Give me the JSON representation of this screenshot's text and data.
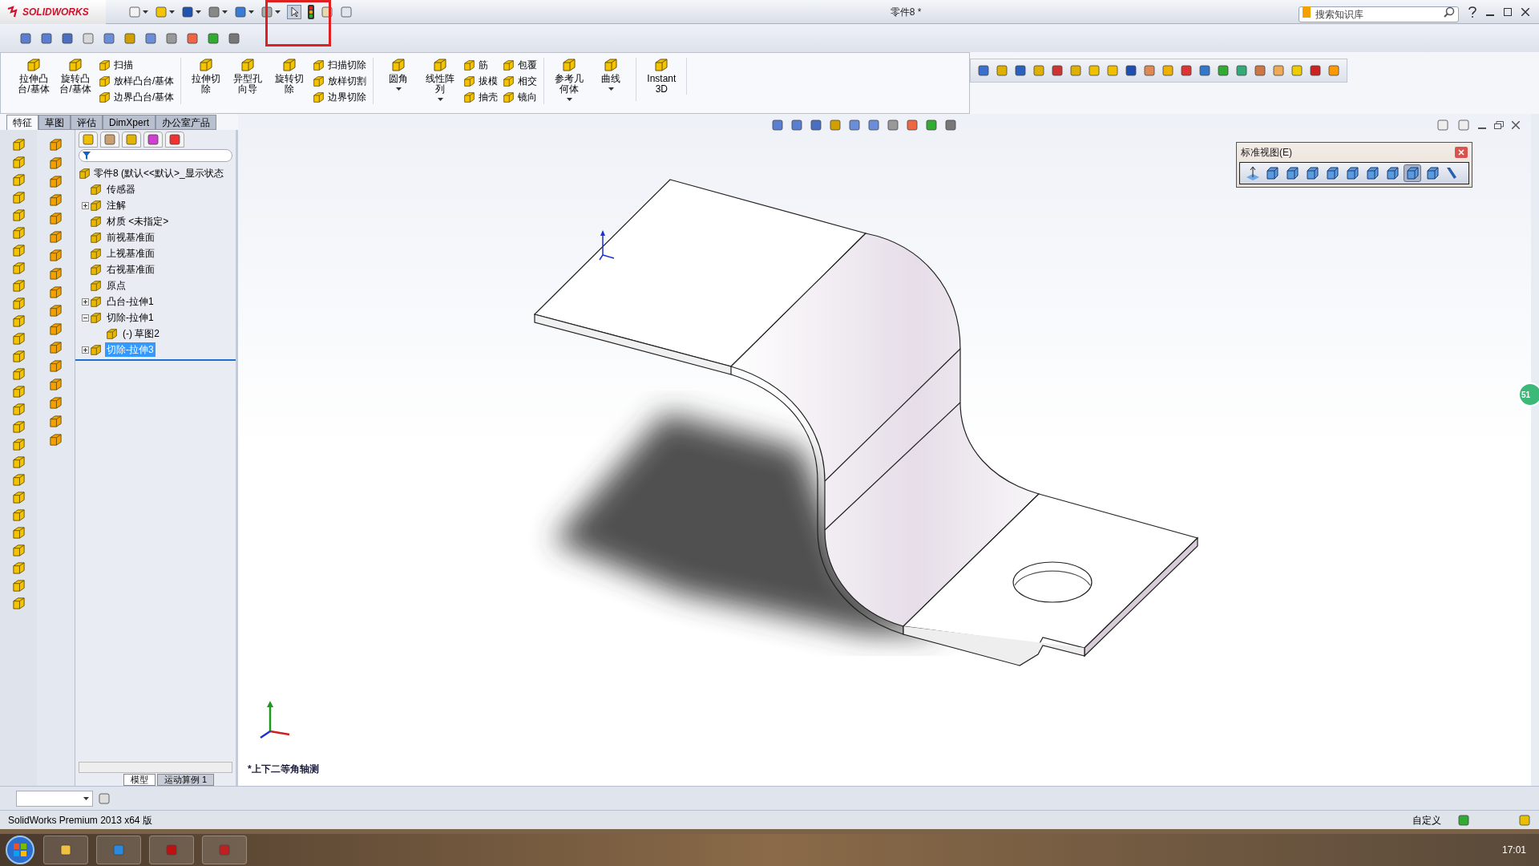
{
  "title_bar": {
    "logo": "SOLIDWORKS",
    "document_title": "零件8 *",
    "search": {
      "placeholder": "搜索知识库"
    }
  },
  "command_manager": {
    "groups": [
      {
        "items": [
          {
            "kind": "large",
            "label": "拉伸凸台/基体"
          },
          {
            "kind": "large",
            "label": "旋转凸台/基体"
          },
          {
            "kind": "column",
            "children": [
              {
                "label": "扫描"
              },
              {
                "label": "放样凸台/基体"
              },
              {
                "label": "边界凸台/基体"
              }
            ]
          }
        ]
      },
      {
        "items": [
          {
            "kind": "large",
            "label": "拉伸切除"
          },
          {
            "kind": "large",
            "label": "异型孔向导"
          },
          {
            "kind": "large",
            "label": "旋转切除"
          },
          {
            "kind": "column",
            "children": [
              {
                "label": "扫描切除"
              },
              {
                "label": "放样切割"
              },
              {
                "label": "边界切除"
              }
            ]
          }
        ]
      },
      {
        "items": [
          {
            "kind": "dropdown",
            "label": "圆角"
          },
          {
            "kind": "dropdown",
            "label": "线性阵列"
          },
          {
            "kind": "column",
            "children": [
              {
                "label": "筋"
              },
              {
                "label": "拔模"
              },
              {
                "label": "抽壳"
              }
            ]
          },
          {
            "kind": "column",
            "children": [
              {
                "label": "包覆"
              },
              {
                "label": "相交"
              },
              {
                "label": "镜向"
              }
            ]
          }
        ]
      },
      {
        "items": [
          {
            "kind": "dropdown",
            "label": "参考几何体"
          },
          {
            "kind": "dropdown",
            "label": "曲线"
          }
        ]
      },
      {
        "items": [
          {
            "kind": "large",
            "label": "Instant3D"
          }
        ]
      }
    ]
  },
  "tabs": [
    {
      "label": "特征",
      "selected": true
    },
    {
      "label": "草图",
      "selected": false
    },
    {
      "label": "评估",
      "selected": false
    },
    {
      "label": "DimXpert",
      "selected": false
    },
    {
      "label": "办公室产品",
      "selected": false
    }
  ],
  "feature_tree": {
    "root": "零件8  (默认<<默认>_显示状态",
    "items": [
      {
        "label": "传感器",
        "selected": false
      },
      {
        "label": "注解",
        "expanded": false,
        "selected": false
      },
      {
        "label": "材质 <未指定>",
        "selected": false
      },
      {
        "label": "前视基准面",
        "selected": false
      },
      {
        "label": "上视基准面",
        "selected": false
      },
      {
        "label": "右视基准面",
        "selected": false
      },
      {
        "label": "原点",
        "selected": false
      },
      {
        "label": "凸台-拉伸1",
        "expanded": false,
        "selected": false
      },
      {
        "label": "切除-拉伸1",
        "expanded": true,
        "selected": false,
        "children": [
          {
            "label": "(-) 草图2",
            "selected": false
          }
        ]
      },
      {
        "label": "切除-拉伸3",
        "expanded": false,
        "selected": true
      }
    ]
  },
  "standard_views": {
    "title": "标准视图(E)",
    "views": [
      {
        "selected": false
      },
      {
        "selected": false
      },
      {
        "selected": false
      },
      {
        "selected": false
      },
      {
        "selected": false
      },
      {
        "selected": false
      },
      {
        "selected": false
      },
      {
        "selected": true
      },
      {
        "selected": false
      }
    ]
  },
  "viewport": {
    "view_name": "*上下二等角轴测",
    "side_badge": "51"
  },
  "bottom_tabs": [
    {
      "label": "模型",
      "selected": true
    },
    {
      "label": "运动算例 1",
      "selected": false
    }
  ],
  "status_bar": {
    "product": "SolidWorks Premium 2013 x64 版",
    "units": "自定义"
  },
  "taskbar": {
    "clock": "17:01"
  }
}
